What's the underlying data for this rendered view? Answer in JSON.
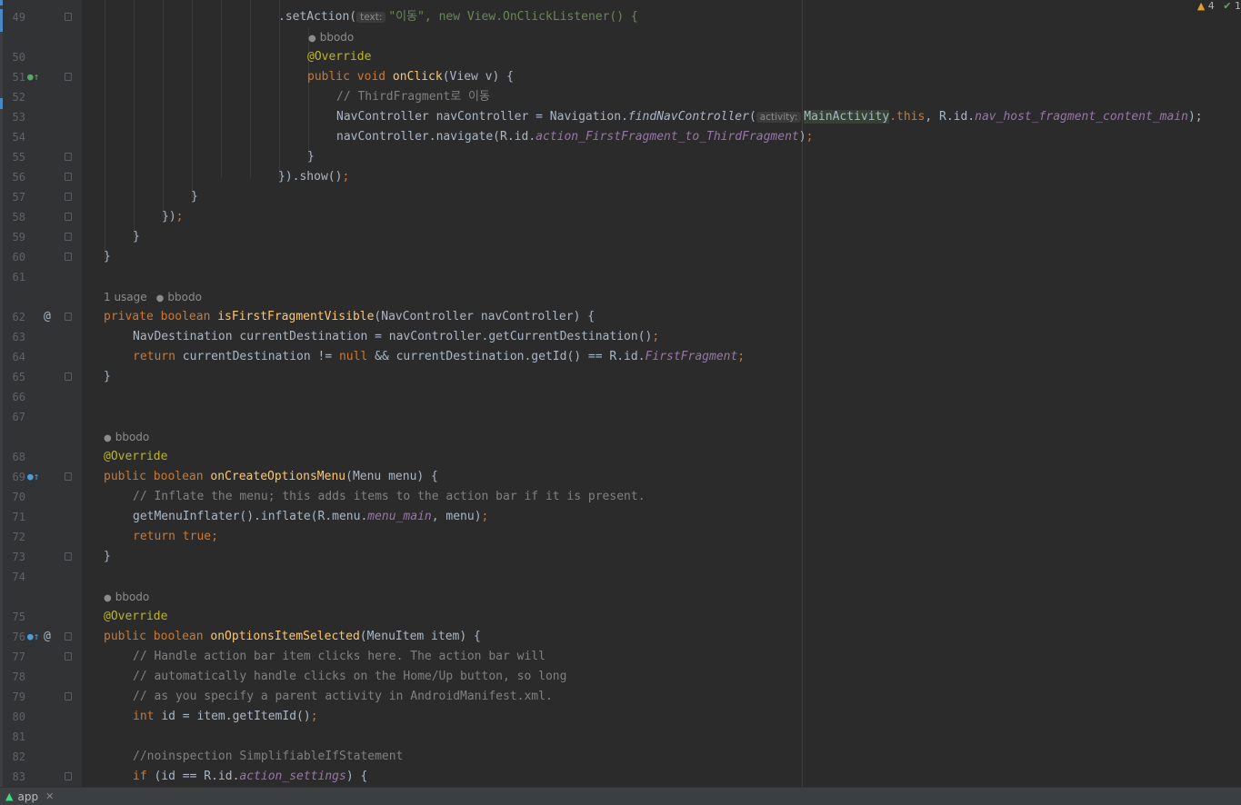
{
  "editor": {
    "inspection": {
      "warnings": "4",
      "weak_warnings": "1"
    },
    "lines": [
      {
        "n": "49",
        "code": ".setAction("
      },
      {
        "n": "50",
        "code": "@Override"
      },
      {
        "n": "51",
        "code": "public void onClick(View v) {"
      },
      {
        "n": "52",
        "code": "// ThirdFragment로 이동"
      },
      {
        "n": "53",
        "code": "NavController navController = Navigation.findNavController("
      },
      {
        "n": "54",
        "code": "navController.navigate(R.id.action_FirstFragment_to_ThirdFragment);"
      },
      {
        "n": "55",
        "code": "}"
      },
      {
        "n": "56",
        "code": "}).show();"
      },
      {
        "n": "57",
        "code": "}"
      },
      {
        "n": "58",
        "code": "});"
      },
      {
        "n": "59",
        "code": "}"
      },
      {
        "n": "60",
        "code": "}"
      },
      {
        "n": "61",
        "code": ""
      },
      {
        "n": "62",
        "code": "private boolean isFirstFragmentVisible(NavController navController) {"
      },
      {
        "n": "63",
        "code": "NavDestination currentDestination = navController.getCurrentDestination();"
      },
      {
        "n": "64",
        "code": "return currentDestination != null && currentDestination.getId() == R.id.FirstFragment;"
      },
      {
        "n": "65",
        "code": "}"
      },
      {
        "n": "66",
        "code": ""
      },
      {
        "n": "67",
        "code": ""
      },
      {
        "n": "68",
        "code": "@Override"
      },
      {
        "n": "69",
        "code": "public boolean onCreateOptionsMenu(Menu menu) {"
      },
      {
        "n": "70",
        "code": "// Inflate the menu; this adds items to the action bar if it is present."
      },
      {
        "n": "71",
        "code": "getMenuInflater().inflate(R.menu.menu_main, menu);"
      },
      {
        "n": "72",
        "code": "return true;"
      },
      {
        "n": "73",
        "code": "}"
      },
      {
        "n": "74",
        "code": ""
      },
      {
        "n": "75",
        "code": "@Override"
      },
      {
        "n": "76",
        "code": "public boolean onOptionsItemSelected(MenuItem item) {"
      },
      {
        "n": "77",
        "code": "// Handle action bar item clicks here. The action bar will"
      },
      {
        "n": "78",
        "code": "// automatically handle clicks on the Home/Up button, so long"
      },
      {
        "n": "79",
        "code": "// as you specify a parent activity in AndroidManifest.xml."
      },
      {
        "n": "80",
        "code": "int id = item.getItemId();"
      },
      {
        "n": "81",
        "code": ""
      },
      {
        "n": "82",
        "code": "//noinspection SimplifiableIfStatement"
      },
      {
        "n": "83",
        "code": "if (id == R.id.action_settings) {"
      }
    ],
    "tokens": {
      "l49_hint": "text:",
      "l49_rest": "\"이동\", new View.OnClickListener() {",
      "l53_hint": "activity:",
      "l53_rest_main": "MainActivity",
      "l53_rest_tail": ".this, R.id.nav_host_fragment_content_main);"
    },
    "inlays": {
      "author": "bbodo",
      "usages": "1 usage"
    }
  },
  "bottom_tab": {
    "label": "app",
    "icon": "android-icon"
  }
}
